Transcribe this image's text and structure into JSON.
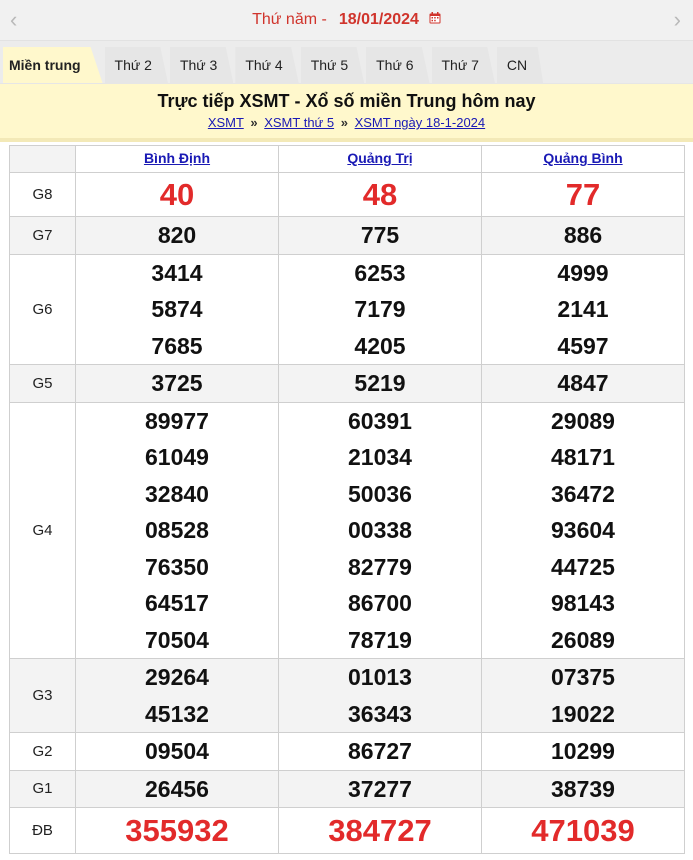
{
  "date_bar": {
    "day_label": "Thứ năm -",
    "date": "18/01/2024",
    "prev_icon": "chevron-left-icon",
    "next_icon": "chevron-right-icon",
    "calendar_icon": "calendar-icon"
  },
  "tabs": [
    "Miền trung",
    "Thứ 2",
    "Thứ 3",
    "Thứ 4",
    "Thứ 5",
    "Thứ 6",
    "Thứ 7",
    "CN"
  ],
  "heading": {
    "title": "Trực tiếp XSMT - Xổ số miền Trung hôm nay",
    "crumbs": [
      "XSMT",
      "XSMT thứ 5",
      "XSMT ngày 18-1-2024"
    ],
    "separator": "»"
  },
  "provinces": [
    "Bình Định",
    "Quảng Trị",
    "Quảng Bình"
  ],
  "rows": [
    {
      "label": "G8",
      "values": [
        [
          "40"
        ],
        [
          "48"
        ],
        [
          "77"
        ]
      ]
    },
    {
      "label": "G7",
      "values": [
        [
          "820"
        ],
        [
          "775"
        ],
        [
          "886"
        ]
      ]
    },
    {
      "label": "G6",
      "values": [
        [
          "3414",
          "5874",
          "7685"
        ],
        [
          "6253",
          "7179",
          "4205"
        ],
        [
          "4999",
          "2141",
          "4597"
        ]
      ]
    },
    {
      "label": "G5",
      "values": [
        [
          "3725"
        ],
        [
          "5219"
        ],
        [
          "4847"
        ]
      ]
    },
    {
      "label": "G4",
      "values": [
        [
          "89977",
          "61049",
          "32840",
          "08528",
          "76350",
          "64517",
          "70504"
        ],
        [
          "60391",
          "21034",
          "50036",
          "00338",
          "82779",
          "86700",
          "78719"
        ],
        [
          "29089",
          "48171",
          "36472",
          "93604",
          "44725",
          "98143",
          "26089"
        ]
      ]
    },
    {
      "label": "G3",
      "values": [
        [
          "29264",
          "45132"
        ],
        [
          "01013",
          "36343"
        ],
        [
          "07375",
          "19022"
        ]
      ]
    },
    {
      "label": "G2",
      "values": [
        [
          "09504"
        ],
        [
          "86727"
        ],
        [
          "10299"
        ]
      ]
    },
    {
      "label": "G1",
      "values": [
        [
          "26456"
        ],
        [
          "37277"
        ],
        [
          "38739"
        ]
      ]
    },
    {
      "label": "ĐB",
      "values": [
        [
          "355932"
        ],
        [
          "384727"
        ],
        [
          "471039"
        ]
      ]
    }
  ],
  "colors": {
    "accent_red": "#e22a2a",
    "link_blue": "#1a1ab5",
    "heading_bg": "#fff8cc"
  }
}
